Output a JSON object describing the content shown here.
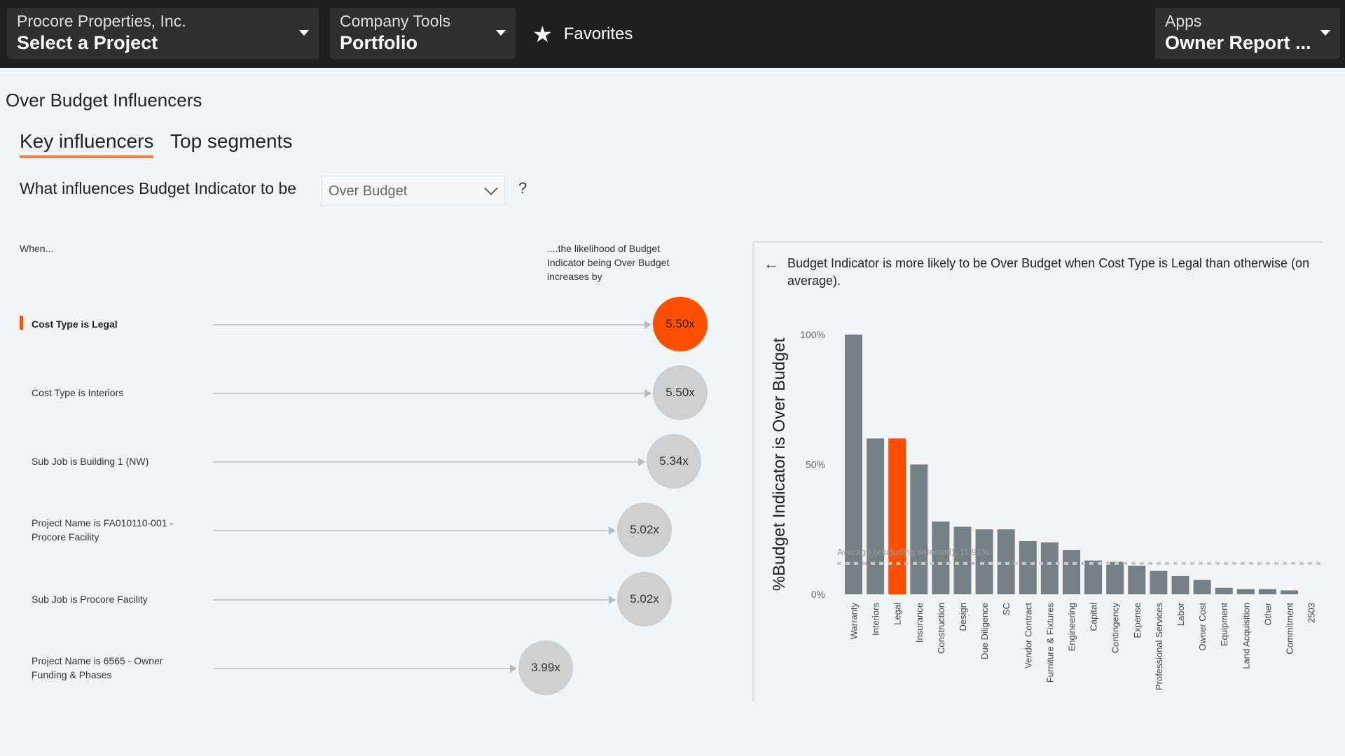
{
  "topbar": {
    "project": {
      "company": "Procore Properties, Inc.",
      "label": "Select a Project"
    },
    "tools": {
      "label": "Company Tools",
      "value": "Portfolio"
    },
    "favorites": "Favorites",
    "apps": {
      "label": "Apps",
      "value": "Owner Report ..."
    }
  },
  "page": {
    "title": "Over Budget Influencers",
    "tabs": [
      "Key influencers",
      "Top segments"
    ],
    "question": "What influences Budget Indicator to be",
    "selected": "Over Budget",
    "help": "?"
  },
  "influencers": {
    "when_header": "When...",
    "likelihood_header": "....the likelihood of Budget Indicator being Over Budget increases by",
    "rows": [
      {
        "label": "Cost Type is Legal",
        "value": "5.50x",
        "selected": true
      },
      {
        "label": "Cost Type is Interiors",
        "value": "5.50x"
      },
      {
        "label": "Sub Job is Building 1 (NW)",
        "value": "5.34x"
      },
      {
        "label": "Project Name is FA010110-001 - Procore Facility",
        "value": "5.02x"
      },
      {
        "label": "Sub Job is Procore Facility",
        "value": "5.02x"
      },
      {
        "label": "Project Name is 6565 - Owner Funding & Phases",
        "value": "3.99x"
      }
    ]
  },
  "detail": {
    "text": "Budget Indicator is more likely to be Over Budget when Cost Type is Legal than otherwise (on average)."
  },
  "chart_data": {
    "type": "bar",
    "ylabel": "%Budget Indicator is Over Budget",
    "ylim": [
      0,
      100
    ],
    "yticks": [
      "0%",
      "50%",
      "100%"
    ],
    "categories": [
      "Warranty",
      "Interiors",
      "Legal",
      "Insurance",
      "Construction",
      "Design",
      "Due Diligence",
      "SC",
      "Vendor Contract",
      "Furniture & Fixtures",
      "Engineering",
      "Capital",
      "Contingency",
      "Expense",
      "Professional Services",
      "Labor",
      "Owner Cost",
      "Equipment",
      "Land Acquisition",
      "Other",
      "Commitment",
      "2503"
    ],
    "values": [
      100,
      60,
      60,
      50,
      28,
      26,
      25,
      25,
      20.5,
      20,
      17,
      13,
      12.5,
      11,
      9,
      7,
      5.5,
      2.5,
      2,
      2,
      1.5,
      0
    ],
    "highlight": "Legal",
    "average": {
      "label": "Average (excluding selected): 11.91%",
      "value": 11.91
    },
    "colors": {
      "bar": "#747f86",
      "highlight": "#fe5000",
      "average": "#c8c8c8"
    }
  }
}
